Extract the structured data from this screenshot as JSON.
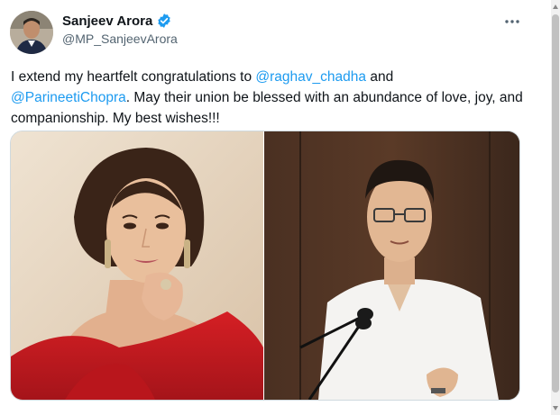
{
  "author": {
    "display_name": "Sanjeev Arora",
    "handle": "@MP_SanjeevArora",
    "verified_icon": "verified-badge-icon"
  },
  "tweet": {
    "text_part1": "I extend my heartfelt congratulations to ",
    "mention1": "@raghav_chadha",
    "text_part2": " and ",
    "mention2": "@ParineetiChopra",
    "text_part3": ". May their union be blessed with an abundance of love, joy, and companionship. My best wishes!!!"
  },
  "icons": {
    "more": "more-options-icon"
  },
  "colors": {
    "mention": "#1d9bf0",
    "verified": "#1d9bf0",
    "text": "#0f1419",
    "secondary": "#536471"
  }
}
